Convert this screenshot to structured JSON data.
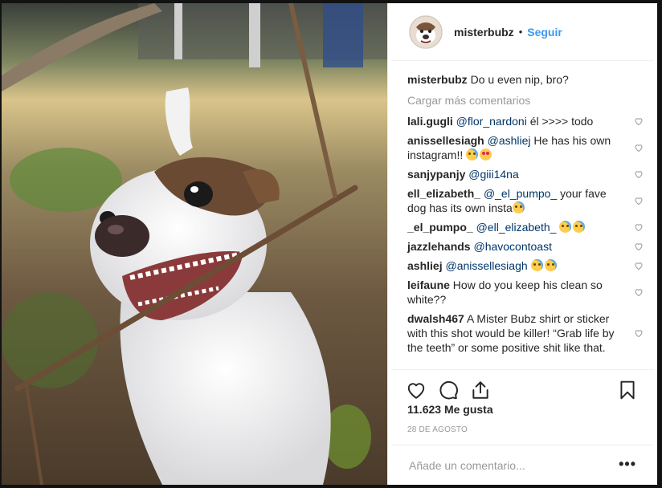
{
  "post": {
    "username": "misterbubz",
    "separator": "•",
    "follow_label": "Seguir",
    "photo_alt": "dog-with-stick-photo"
  },
  "caption": {
    "user": "misterbubz",
    "text": "Do u even nip, bro?"
  },
  "load_more": "Cargar más comentarios",
  "comments": [
    {
      "user": "lali.gugli",
      "mention": "@flor_nardoni",
      "text": " él >>>> todo"
    },
    {
      "user": "anissellesiagh",
      "mention": "@ashliej",
      "text": " He has his own instagram!! "
    },
    {
      "user": "sanjypanjy",
      "mention": "@giii14na",
      "text": ""
    },
    {
      "user": "ell_elizabeth_",
      "mention": "@_el_pumpo_",
      "text": " your fave dog has its own insta"
    },
    {
      "user": "_el_pumpo_",
      "mention": "@ell_elizabeth_",
      "text": " "
    },
    {
      "user": "jazzlehands",
      "mention": "@havocontoast",
      "text": ""
    },
    {
      "user": "ashliej",
      "mention": "@anissellesiagh",
      "text": " "
    },
    {
      "user": "leifaune",
      "mention": "",
      "text": " How do you keep his clean so white??"
    },
    {
      "user": "dwalsh467",
      "mention": "",
      "text": " A Mister Bubz shirt or sticker with this shot would be killer! “Grab life by the teeth” or some positive shit like that."
    }
  ],
  "likes": "11.623 Me gusta",
  "date": "28 DE AGOSTO",
  "add_comment_placeholder": "Añade un comentario...",
  "more_label": "•••",
  "icons": {
    "like": "heart-icon",
    "comment": "comment-icon",
    "share": "share-icon",
    "save": "bookmark-icon"
  },
  "colors": {
    "link": "#3897f0",
    "mention": "#003569",
    "muted": "#999999"
  }
}
